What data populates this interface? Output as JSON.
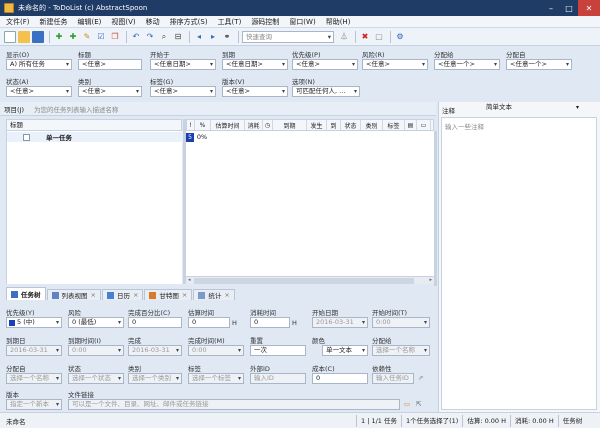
{
  "window": {
    "title": "未命名的 - ToDoList (c) AbstractSpoon",
    "minimize": "–",
    "maximize": "□",
    "close": "✕"
  },
  "menu": [
    "文件(F)",
    "新建任务",
    "编辑(E)",
    "视图(V)",
    "移动",
    "排序方式(S)",
    "工具(T)",
    "源码控制",
    "窗口(W)",
    "帮助(H)"
  ],
  "toolbar": {
    "quick_search_placeholder": "快速查询"
  },
  "filters": {
    "row1": [
      {
        "label": "显示(O)",
        "value": "A) 所有任务"
      },
      {
        "label": "标题",
        "value": "<任意>"
      },
      {
        "label": "开始于",
        "value": "<任意日期>"
      },
      {
        "label": "到期",
        "value": "<任意日期>"
      },
      {
        "label": "优先级(P)",
        "value": "<任意>"
      },
      {
        "label": "风险(R)",
        "value": "<任意>"
      },
      {
        "label": "分配给",
        "value": "<任意一个>"
      },
      {
        "label": "分配自",
        "value": "<任意一个>"
      }
    ],
    "row2": [
      {
        "label": "状态(A)",
        "value": "<任意>"
      },
      {
        "label": "类别",
        "value": "<任意>"
      },
      {
        "label": "标签(G)",
        "value": "<任意>"
      },
      {
        "label": "版本(V)",
        "value": "<任意>"
      },
      {
        "label": "选项(N)",
        "value": "可匹配任何人, ..."
      }
    ]
  },
  "task_entry": {
    "label": "项目(J)",
    "placeholder": "为您的任务列表输入描述名称"
  },
  "tree": {
    "header": "标题",
    "rows": [
      {
        "title": "单一任务"
      }
    ]
  },
  "grid": {
    "columns": [
      "!",
      "%",
      "估算时间",
      "消耗",
      "",
      "到期",
      "发生",
      "到",
      "状态",
      "类别",
      "标签",
      "",
      ""
    ],
    "rows": [
      {
        "index": "5",
        "percent": "0%"
      }
    ]
  },
  "tabs": [
    {
      "label": "任务树",
      "closable": false
    },
    {
      "label": "列表视图",
      "closable": true
    },
    {
      "label": "日历",
      "closable": true
    },
    {
      "label": "甘特图",
      "closable": true
    },
    {
      "label": "统计",
      "closable": true
    }
  ],
  "comments": {
    "label": "注释",
    "format": "简单文本",
    "placeholder": "输入一些注释"
  },
  "props": {
    "priority": {
      "label": "优先级(Y)",
      "value": "5 (中)"
    },
    "risk": {
      "label": "风险",
      "value": "0 (最低)"
    },
    "percent": {
      "label": "完成百分比(C)",
      "value": "0"
    },
    "estimate": {
      "label": "估算时间",
      "value": "0",
      "unit": "H"
    },
    "spent": {
      "label": "消耗时间",
      "value": "0",
      "unit": "H"
    },
    "start_date": {
      "label": "开始日期",
      "value": "2016-03-31"
    },
    "start_time": {
      "label": "开始时间(T)",
      "value": "0:00"
    },
    "due_date": {
      "label": "到期日",
      "value": "2016-03-31"
    },
    "due_time": {
      "label": "到期时间(I)",
      "value": "0:00"
    },
    "done": {
      "label": "完成",
      "value": "2016-03-31"
    },
    "done_time": {
      "label": "完成时间(M)",
      "value": "0:00"
    },
    "recurrence": {
      "label": "重置",
      "value": "一次"
    },
    "color": {
      "label": "颜色",
      "value": "单一文本"
    },
    "alloc_to": {
      "label": "分配给",
      "value": "选择一个名称"
    },
    "alloc_by": {
      "label": "分配自",
      "value": "选择一个名称"
    },
    "status": {
      "label": "状态",
      "value": "选择一个状态"
    },
    "category": {
      "label": "类别",
      "value": "选择一个类别"
    },
    "tags": {
      "label": "标签",
      "value": "选择一个标签"
    },
    "external_id": {
      "label": "外部ID",
      "value": "输入ID"
    },
    "cost": {
      "label": "成本(C)",
      "value": "0"
    },
    "depends": {
      "label": "依赖性",
      "value": "输入任务ID"
    },
    "version": {
      "label": "版本",
      "value": "指定一个新本"
    },
    "file_link": {
      "label": "文件链接",
      "value": "可以是一个文件、目录、网址、邮件或任务链接"
    }
  },
  "statusbar": {
    "left": "未命名",
    "count": "1 | 1/1 任务",
    "selected": "1个任务选择了(1)",
    "estimate": "估算: 0.00 H",
    "spent": "消耗: 0.00 H",
    "view": "任务树"
  }
}
